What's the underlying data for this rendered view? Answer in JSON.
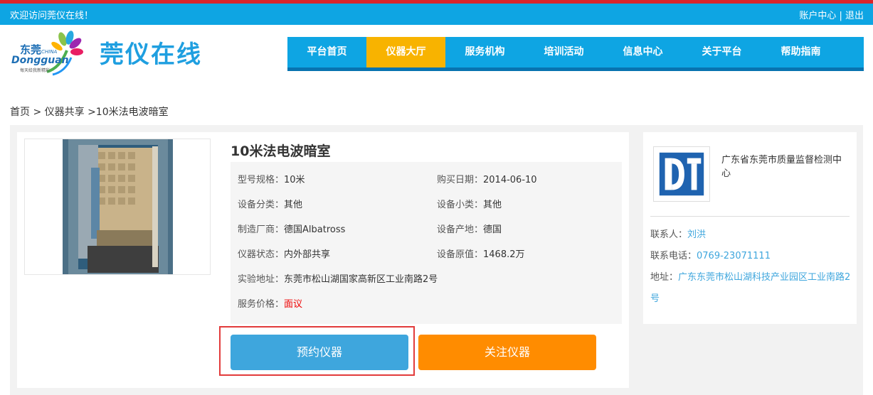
{
  "topbar": {
    "welcome": "欢迎访问莞仪在线！",
    "account_center": "账户中心",
    "separator": " | ",
    "logout": "退出"
  },
  "logo": {
    "city_cn": "东莞",
    "city_en": "Dongguan",
    "china": "CHINA",
    "slogan": "每天给我新精彩"
  },
  "site_title": "莞仪在线",
  "nav": {
    "items": [
      {
        "label": "平台首页"
      },
      {
        "label": "仪器大厅",
        "active": true
      },
      {
        "label": "服务机构"
      },
      {
        "label": "培训活动"
      },
      {
        "label": "信息中心"
      },
      {
        "label": "关于平台"
      },
      {
        "label": "帮助指南"
      }
    ]
  },
  "breadcrumb": "首页 > 仪器共享 >10米法电波暗室",
  "instrument": {
    "title": "10米法电波暗室",
    "fields": {
      "model_label": "型号规格：",
      "model_value": "10米",
      "purchase_label": "购买日期：",
      "purchase_value": "2014-06-10",
      "category_label": "设备分类：",
      "category_value": "其他",
      "subcategory_label": "设备小类：",
      "subcategory_value": "其他",
      "maker_label": "制造厂商：",
      "maker_value": "德国Albatross",
      "origin_label": "设备产地：",
      "origin_value": "德国",
      "status_label": "仪器状态：",
      "status_value": "内外部共享",
      "price_label": "设备原值：",
      "price_value": "1468.2万",
      "lab_label": "实验地址：",
      "lab_value": "东莞市松山湖国家高新区工业南路2号",
      "service_label": "服务价格：",
      "service_value": "面议"
    },
    "book_button": "预约仪器",
    "follow_button": "关注仪器"
  },
  "organization": {
    "logo_text": "DQT",
    "name": "广东省东莞市质量监督检测中心",
    "contact_label": "联系人：",
    "contact_value": "刘洪",
    "phone_label": "联系电话：",
    "phone_value": "0769-23071111",
    "address_label": "地址：",
    "address_value": "广东东莞市松山湖科技产业园区工业南路2号"
  },
  "colors": {
    "topbar": "#0ea5e3",
    "nav_active": "#f8b300",
    "book_button": "#3ea6dd",
    "follow_button": "#ff8c00",
    "price_red": "#ee0000",
    "highlight_border": "#e23b3b"
  }
}
